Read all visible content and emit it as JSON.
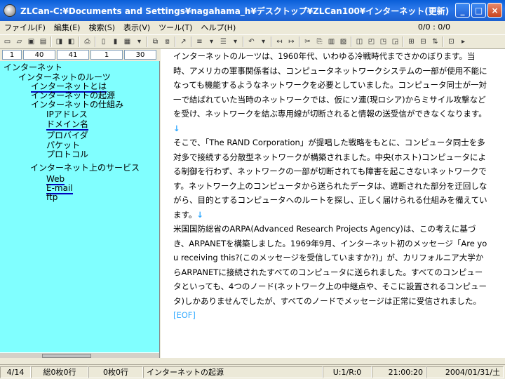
{
  "window": {
    "title": "ZLCan-C:¥Documents and Settings¥nagahama_h¥デスクトップ¥ZLCan100¥インターネット(更新)",
    "minimize": "_",
    "maximize": "□",
    "close": "×"
  },
  "menu": {
    "items": [
      "ファイル(F)",
      "編集(E)",
      "検索(S)",
      "表示(V)",
      "ツール(T)",
      "ヘルプ(H)"
    ],
    "position": "0/0 : 0/0"
  },
  "numbar": {
    "fields": [
      "1",
      "40",
      "41",
      "1",
      "30"
    ]
  },
  "tree": {
    "nodes": [
      {
        "label": "インターネット"
      },
      {
        "label": "インターネットのルーツ"
      },
      {
        "label": "インターネットとは"
      },
      {
        "label": "インターネットの起源"
      },
      {
        "label": "インターネットの仕組み"
      },
      {
        "label": "IPアドレス"
      },
      {
        "label": "ドメイン名"
      },
      {
        "label": "プロバイダ"
      },
      {
        "label": "パケット"
      },
      {
        "label": "プロトコル"
      },
      {
        "label": "インターネット上のサービス"
      },
      {
        "label": "Web"
      },
      {
        "label": "E-mail"
      },
      {
        "label": "ftp"
      }
    ]
  },
  "editor": {
    "paragraph1": " インターネットのルーツは、1960年代、いわゆる冷戦時代までさかのぼります。当時、アメリカの軍事関係者は、コンピュータネットワークシステムの一部が使用不能になっても機能するようなネットワークを必要としていました。コンピュータ同士が一対一で結ばれていた当時のネットワークでは、仮にソ連(現ロシア)からミサイル攻撃などを受け、ネットワークを結ぶ専用線が切断されると情報の送受信ができなくなります。",
    "paragraph2": " そこで、「The RAND Corporation」が提唱した戦略をもとに、コンピュータ同士を多対多で接続する分散型ネットワークが構築されました。中央(ホスト)コンピュータによる制御を行わず、ネットワークの一部が切断されても障害を起こさないネットワークです。ネットワーク上のコンピュータから送られたデータは、遮断された部分を迂回しながら、目的とするコンピュータへのルートを探し、正しく届けられる仕組みを備えています。",
    "paragraph3": " 米国国防総省のARPA(Advanced Research Projects Agency)は、この考えに基づき、ARPANETを構築しました。1969年9月、インターネット初のメッセージ「Are you receiving this?(このメッセージを受信していますか?)」が、カリフォルニア大学からARPANETに接続されたすべてのコンピュータに送られました。すべてのコンピュータといっても、4つのノード(ネットワーク上の中継点や、そこに設置されるコンピュータ)しかありませんでしたが、すべてのノードでメッセージは正常に受信されました。",
    "return_mark": "↓",
    "eof_mark": "[EOF]"
  },
  "status": {
    "page": "4/14",
    "total": "総0枚0行",
    "count": "0枚0行",
    "node": "インターネットの起源",
    "ur": "U:1/R:0",
    "time": "21:00:20",
    "date": "2004/01/31/土"
  }
}
